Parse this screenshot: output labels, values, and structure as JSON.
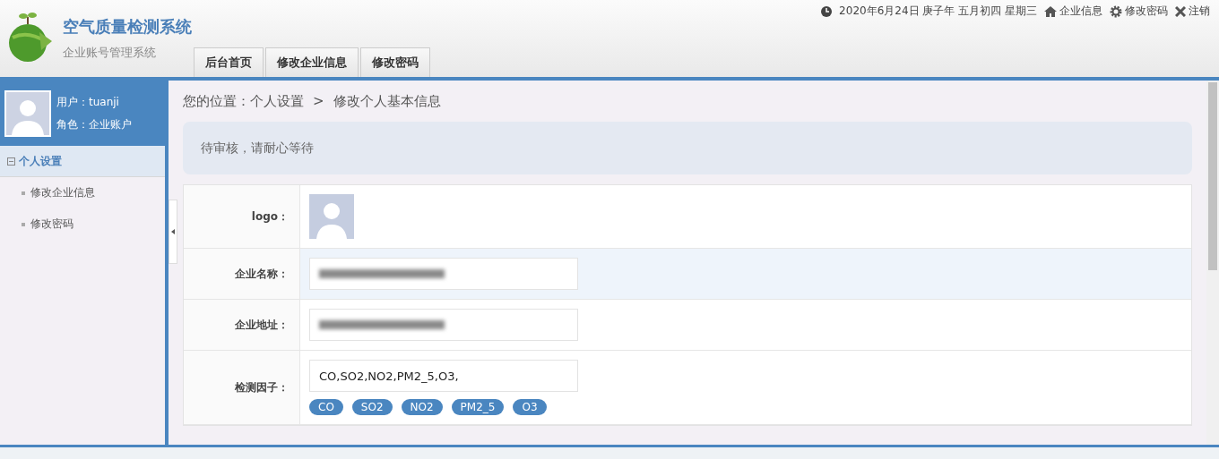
{
  "header": {
    "title": "空气质量检测系统",
    "subtitle": "企业账号管理系统",
    "nav_tabs": [
      {
        "label": "后台首页",
        "selected": false
      },
      {
        "label": "修改企业信息",
        "selected": false
      },
      {
        "label": "修改密码",
        "selected": false
      }
    ],
    "date": "2020年6月24日 庚子年 五月初四 星期三",
    "links": [
      {
        "kind": "home",
        "label": "企业信息"
      },
      {
        "kind": "gear",
        "label": "修改密码"
      },
      {
        "kind": "close",
        "label": "注销"
      }
    ]
  },
  "sidebar": {
    "user_label": "用户：",
    "user": "tuanji",
    "role_label": "角色：",
    "role": "企业账户",
    "groups": [
      {
        "label": "个人设置",
        "expanded": true,
        "children": [
          {
            "label": "修改企业信息",
            "selected": false
          },
          {
            "label": "修改密码",
            "selected": false
          }
        ]
      }
    ]
  },
  "breadcrumb": {
    "prefix": "您的位置：",
    "items": [
      "个人设置",
      "修改个人基本信息"
    ],
    "separator": ">"
  },
  "notice": "待审核，请耐心等待",
  "form": [
    {
      "kind": "image",
      "label": "logo："
    },
    {
      "kind": "text",
      "label": "企业名称：",
      "redacted": true
    },
    {
      "kind": "text",
      "label": "企业地址：",
      "redacted": true
    },
    {
      "kind": "tags",
      "label": "检测因子：",
      "value": "CO,SO2,NO2,PM2_5,O3,",
      "tags": [
        "CO",
        "SO2",
        "NO2",
        "PM2_5",
        "O3"
      ]
    }
  ]
}
